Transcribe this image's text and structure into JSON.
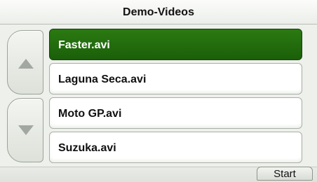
{
  "header": {
    "title": "Demo-Videos"
  },
  "scroll_controls": {
    "up_icon": "triangle-up-icon",
    "down_icon": "triangle-down-icon",
    "arrow_color": "#a3a7a1"
  },
  "file_list": {
    "selected_index": 0,
    "selected_color": "#1f6a0e",
    "items": [
      {
        "label": "Faster.avi",
        "selected": true
      },
      {
        "label": "Laguna Seca.avi",
        "selected": false
      },
      {
        "label": "Moto GP.avi",
        "selected": false
      },
      {
        "label": "Suzuka.avi",
        "selected": false
      }
    ]
  },
  "footer": {
    "start_label": "Start"
  }
}
